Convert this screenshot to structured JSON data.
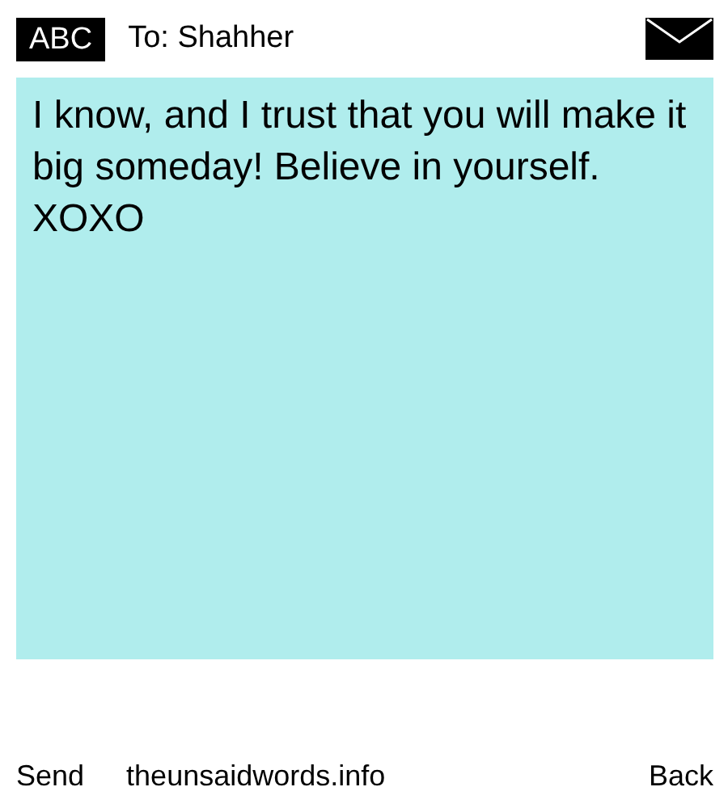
{
  "header": {
    "badge": "ABC",
    "recipient": "To: Shahher"
  },
  "message": {
    "body": "I know, and I trust that you will make it big someday! Believe in yourself.\nXOXO"
  },
  "footer": {
    "send": "Send",
    "site": "theunsaidwords.info",
    "back": "Back"
  }
}
